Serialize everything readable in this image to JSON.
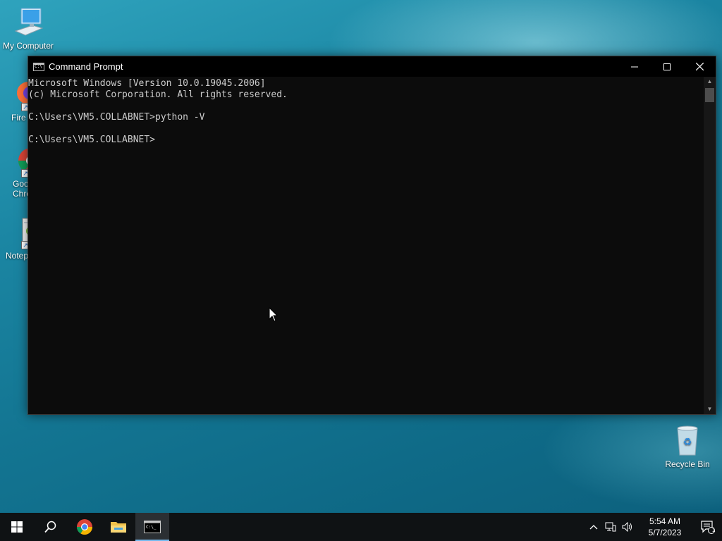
{
  "desktop": {
    "icons": [
      {
        "label": "My Computer"
      },
      {
        "label": "Fire"
      },
      {
        "label": "Goo\nChro"
      },
      {
        "label": "Notep"
      },
      {
        "label": "Recycle Bin"
      }
    ]
  },
  "window": {
    "title": "Command Prompt",
    "controls": {
      "minimize": "–",
      "maximize": "☐",
      "close": "✕"
    },
    "console_lines": [
      "Microsoft Windows [Version 10.0.19045.2006]",
      "(c) Microsoft Corporation. All rights reserved.",
      "",
      "C:\\Users\\VM5.COLLABNET>python -V",
      "",
      "C:\\Users\\VM5.COLLABNET>"
    ]
  },
  "taskbar": {
    "clock_time": "5:54 AM",
    "clock_date": "5/7/2023",
    "notification_count": "1",
    "accent_color": "#76b9ed"
  },
  "icons": [
    "start-icon",
    "search-icon",
    "chrome-icon",
    "file-explorer-icon",
    "cmd-icon",
    "chevron-up-icon",
    "network-icon",
    "volume-icon",
    "action-center-icon"
  ]
}
